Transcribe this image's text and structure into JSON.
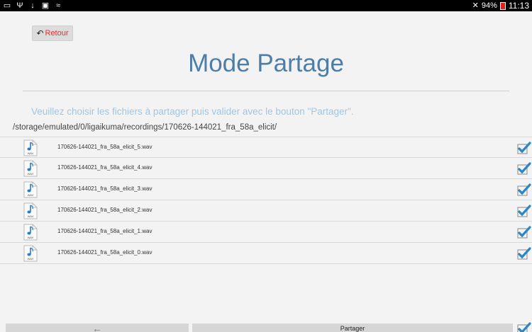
{
  "status_bar": {
    "left_icons": [
      "screen-cast-icon",
      "usb-icon",
      "download-icon",
      "gallery-icon",
      "wifi-icon"
    ],
    "right_icons": [
      "mute-icon",
      "battery-icon"
    ],
    "battery": "94%",
    "time": "11:13"
  },
  "header": {
    "back_label": "Retour",
    "back_icon": "undo-arrow-icon",
    "title": "Mode Partage"
  },
  "instructions": "Veuillez choisir les fichiers à partager puis valider avec le bouton \"Partager\".",
  "path": "/storage/emulated/0/ligaikuma/recordings/170626-144021_fra_58a_elicit/",
  "file_icon": "wav-file-icon",
  "files": [
    {
      "name": "170626-144021_fra_58a_elicit_5.wav",
      "checked": true
    },
    {
      "name": "170626-144021_fra_58a_elicit_4.wav",
      "checked": true
    },
    {
      "name": "170626-144021_fra_58a_elicit_3.wav",
      "checked": true
    },
    {
      "name": "170626-144021_fra_58a_elicit_2.wav",
      "checked": true
    },
    {
      "name": "170626-144021_fra_58a_elicit_1.wav",
      "checked": true
    },
    {
      "name": "170626-144021_fra_58a_elicit_0.wav",
      "checked": true
    }
  ],
  "footer": {
    "back_arrow": "←",
    "share_label": "Partager",
    "select_all_checked": true
  },
  "colors": {
    "title": "#4e7da6",
    "instruction": "#9fc6e5",
    "retour_text": "#e03030",
    "checkbox": "#2a86c9",
    "background": "#f3f3f3"
  }
}
